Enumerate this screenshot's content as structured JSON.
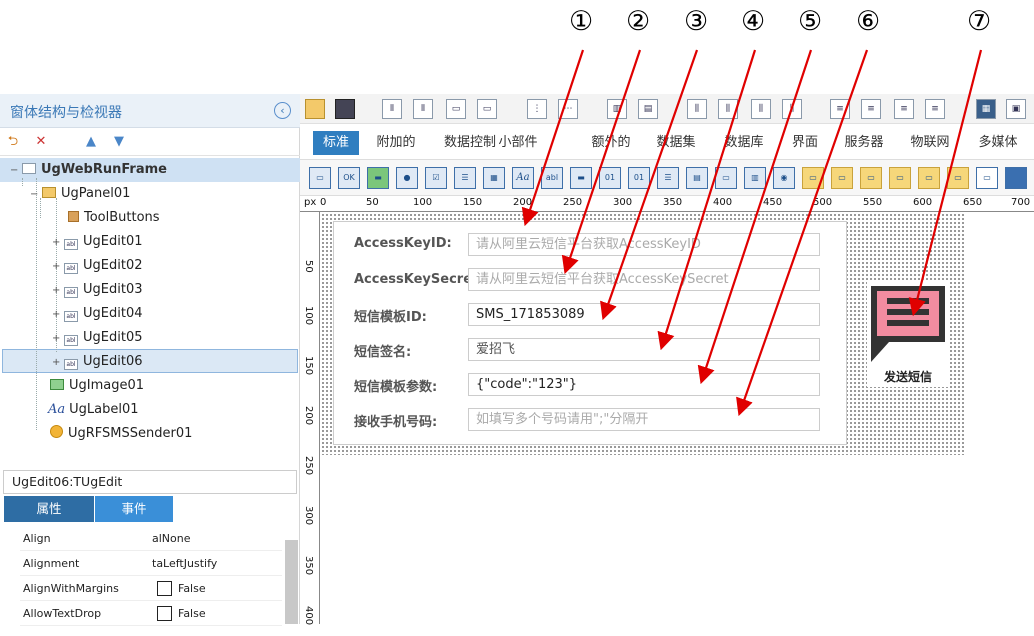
{
  "left_panel": {
    "title": "窗体结构与检视器",
    "tree": [
      {
        "label": "UgWebRunFrame",
        "icon": "form-icon"
      },
      {
        "label": "UgPanel01",
        "icon": "panel-icon"
      },
      {
        "label": "ToolButtons",
        "icon": "toolbuttons-icon"
      },
      {
        "label": "UgEdit01",
        "icon": "edit-icon"
      },
      {
        "label": "UgEdit02",
        "icon": "edit-icon"
      },
      {
        "label": "UgEdit03",
        "icon": "edit-icon"
      },
      {
        "label": "UgEdit04",
        "icon": "edit-icon"
      },
      {
        "label": "UgEdit05",
        "icon": "edit-icon"
      },
      {
        "label": "UgEdit06",
        "icon": "edit-icon"
      },
      {
        "label": "UgImage01",
        "icon": "image-icon"
      },
      {
        "label": "UgLabel01",
        "icon": "label-icon"
      },
      {
        "label": "UgRFSMSSender01",
        "icon": "sms-sender-icon"
      }
    ],
    "inspector_title": "UgEdit06:TUgEdit",
    "tab_properties": "属性",
    "tab_events": "事件",
    "properties": [
      {
        "name": "Align",
        "value": "alNone"
      },
      {
        "name": "Alignment",
        "value": "taLeftJustify"
      },
      {
        "name": "AlignWithMargins",
        "value": "False"
      },
      {
        "name": "AllowTextDrop",
        "value": "False"
      }
    ]
  },
  "tabs": [
    "标准",
    "附加的",
    "数据控制",
    "小部件",
    "额外的",
    "数据集",
    "数据库",
    "界面",
    "服务器",
    "物联网",
    "多媒体"
  ],
  "ruler": {
    "unit": "px",
    "h_ticks": [
      "0",
      "50",
      "100",
      "150",
      "200",
      "250",
      "300",
      "350",
      "400",
      "450",
      "500",
      "550",
      "600",
      "650",
      "700"
    ],
    "v_ticks": [
      "50",
      "100",
      "150",
      "200",
      "250",
      "300",
      "350",
      "400"
    ]
  },
  "form": {
    "fields": [
      {
        "label": "AccessKeyID:",
        "text": "请从阿里云短信平台获取AccessKeyID",
        "is_value": false
      },
      {
        "label": "AccessKeySecret:",
        "text": "请从阿里云短信平台获取AccessKeySecret",
        "is_value": false
      },
      {
        "label": "短信模板ID:",
        "text": "SMS_171853089",
        "is_value": true
      },
      {
        "label": "短信签名:",
        "text": "爱招飞",
        "is_value": true
      },
      {
        "label": "短信模板参数:",
        "text": "{\"code\":\"123\"}",
        "is_value": true
      },
      {
        "label": "接收手机号码:",
        "text": "如填写多个号码请用\";\"分隔开",
        "is_value": false
      }
    ],
    "sms_button_label": "发送短信",
    "sms_icon": "message-icon"
  },
  "annotations": [
    "①",
    "②",
    "③",
    "④",
    "⑤",
    "⑥",
    "⑦"
  ],
  "colors": {
    "accent": "#2f7ec0",
    "tab_active": "#2f7ec0",
    "inspector_tab_active": "#2e6da4",
    "inspector_tab": "#3a8fd8",
    "sms_icon_bg": "#f28ca0",
    "sms_icon_frame": "#333333",
    "arrow": "#e00000"
  }
}
